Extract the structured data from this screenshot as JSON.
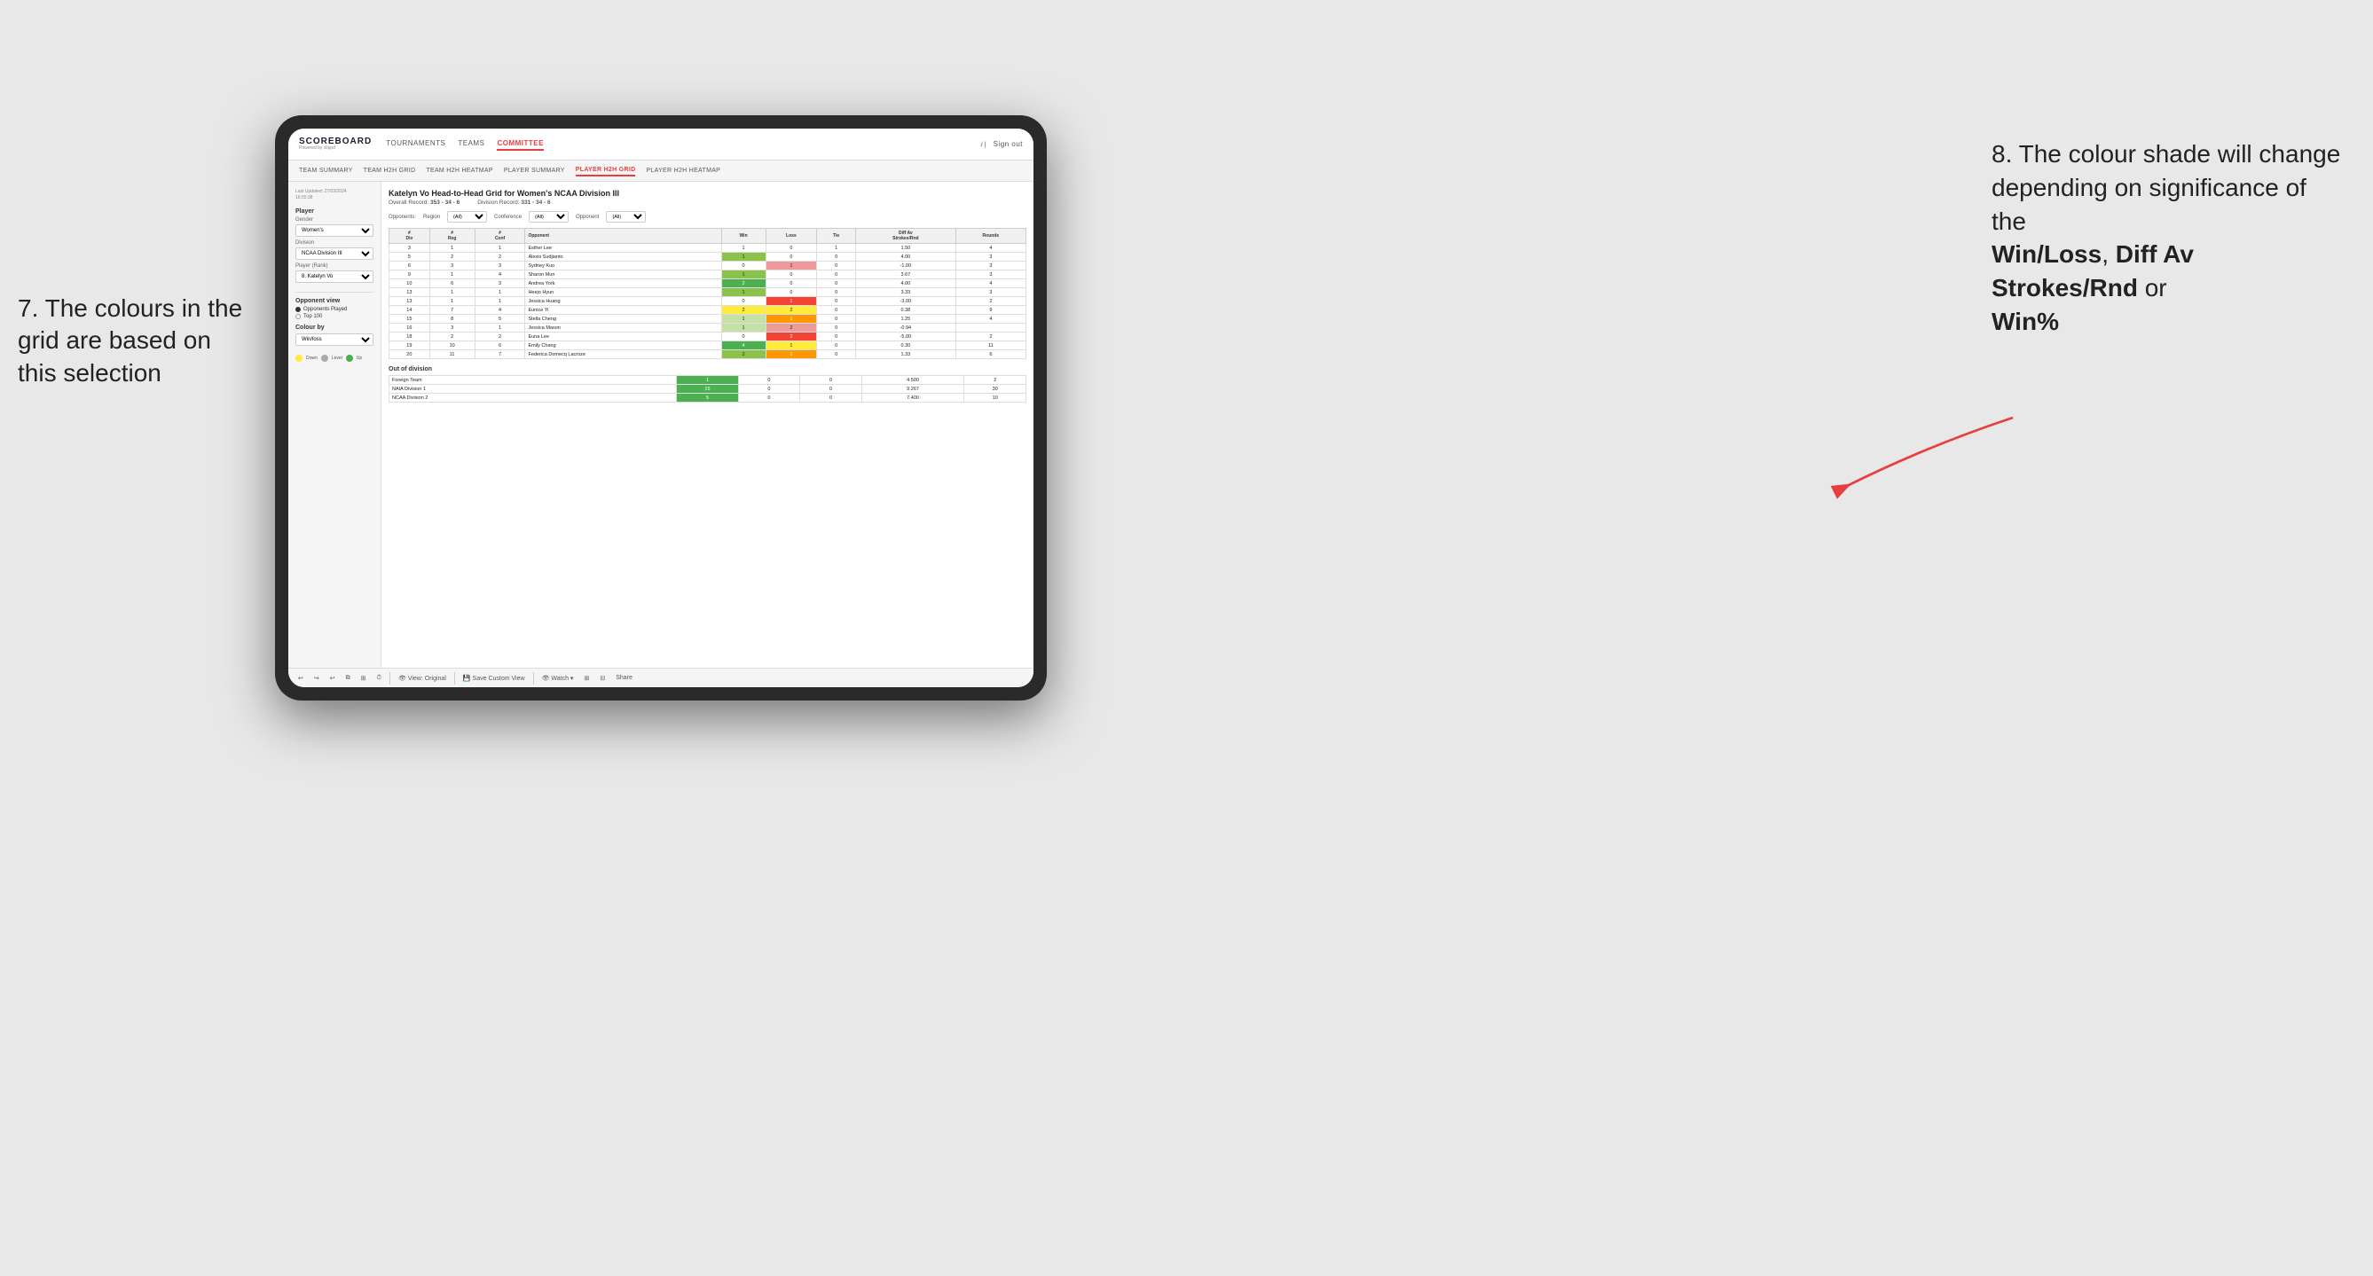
{
  "annotations": {
    "left_title": "7. The colours in the grid are based on this selection",
    "right_title": "8. The colour shade will change depending on significance of the",
    "right_bold1": "Win/Loss",
    "right_bold2": "Diff Av Strokes/Rnd",
    "right_bold3": "Win%",
    "right_connector": "or"
  },
  "nav": {
    "logo": "SCOREBOARD",
    "logo_sub": "Powered by clippd",
    "items": [
      "TOURNAMENTS",
      "TEAMS",
      "COMMITTEE"
    ],
    "right": [
      "Sign out"
    ]
  },
  "subnav": {
    "items": [
      "TEAM SUMMARY",
      "TEAM H2H GRID",
      "TEAM H2H HEATMAP",
      "PLAYER SUMMARY",
      "PLAYER H2H GRID",
      "PLAYER H2H HEATMAP"
    ]
  },
  "left_panel": {
    "last_updated_label": "Last Updated: 27/03/2024",
    "last_updated_time": "16:55:38",
    "player_label": "Player",
    "gender_label": "Gender",
    "gender_value": "Women's",
    "division_label": "Division",
    "division_value": "NCAA Division III",
    "player_rank_label": "Player (Rank)",
    "player_rank_value": "8. Katelyn Vo",
    "opponent_view_label": "Opponent view",
    "radio1": "Opponents Played",
    "radio2": "Top 100",
    "colour_by_label": "Colour by",
    "colour_by_value": "Win/loss",
    "legend_down": "Down",
    "legend_level": "Level",
    "legend_up": "Up"
  },
  "main": {
    "title": "Katelyn Vo Head-to-Head Grid for Women's NCAA Division III",
    "overall_record_label": "Overall Record:",
    "overall_record": "353 - 34 - 6",
    "division_record_label": "Division Record:",
    "division_record": "331 - 34 - 6",
    "opponents_label": "Opponents:",
    "region_label": "Region",
    "conference_label": "Conference",
    "opponent_label": "Opponent",
    "filter_all": "(All)",
    "col_headers": [
      "#\nDiv",
      "#\nReg",
      "#\nConf",
      "Opponent",
      "Win",
      "Loss",
      "Tie",
      "Diff Av\nStrokes/Rnd",
      "Rounds"
    ],
    "rows": [
      {
        "div": "3",
        "reg": "1",
        "conf": "1",
        "opponent": "Esther Lee",
        "win": "1",
        "loss": "0",
        "tie": "1",
        "diff": "1.50",
        "rounds": "4",
        "win_color": "white",
        "loss_color": "white"
      },
      {
        "div": "5",
        "reg": "2",
        "conf": "2",
        "opponent": "Alexis Sudjianto",
        "win": "1",
        "loss": "0",
        "tie": "0",
        "diff": "4.00",
        "rounds": "3",
        "win_color": "green_med",
        "loss_color": "white"
      },
      {
        "div": "6",
        "reg": "3",
        "conf": "3",
        "opponent": "Sydney Kuo",
        "win": "0",
        "loss": "1",
        "tie": "0",
        "diff": "-1.00",
        "rounds": "3",
        "win_color": "white",
        "loss_color": "red_light"
      },
      {
        "div": "9",
        "reg": "1",
        "conf": "4",
        "opponent": "Sharon Mun",
        "win": "1",
        "loss": "0",
        "tie": "0",
        "diff": "3.67",
        "rounds": "3",
        "win_color": "green_med",
        "loss_color": "white"
      },
      {
        "div": "10",
        "reg": "6",
        "conf": "3",
        "opponent": "Andrea York",
        "win": "2",
        "loss": "0",
        "tie": "0",
        "diff": "4.00",
        "rounds": "4",
        "win_color": "green_dark",
        "loss_color": "white"
      },
      {
        "div": "13",
        "reg": "1",
        "conf": "1",
        "opponent": "Heejo Hyun",
        "win": "1",
        "loss": "0",
        "tie": "0",
        "diff": "3.33",
        "rounds": "3",
        "win_color": "green_med",
        "loss_color": "white"
      },
      {
        "div": "13",
        "reg": "1",
        "conf": "1",
        "opponent": "Jessica Huang",
        "win": "0",
        "loss": "1",
        "tie": "0",
        "diff": "-3.00",
        "rounds": "2",
        "win_color": "white",
        "loss_color": "red_dark"
      },
      {
        "div": "14",
        "reg": "7",
        "conf": "4",
        "opponent": "Eunice Yi",
        "win": "2",
        "loss": "2",
        "tie": "0",
        "diff": "0.38",
        "rounds": "9",
        "win_color": "yellow",
        "loss_color": "yellow"
      },
      {
        "div": "15",
        "reg": "8",
        "conf": "5",
        "opponent": "Stella Cheng",
        "win": "1",
        "loss": "1",
        "tie": "0",
        "diff": "1.25",
        "rounds": "4",
        "win_color": "green_light",
        "loss_color": "orange"
      },
      {
        "div": "16",
        "reg": "3",
        "conf": "1",
        "opponent": "Jessica Mason",
        "win": "1",
        "loss": "2",
        "tie": "0",
        "diff": "-0.94",
        "rounds": "",
        "win_color": "green_light",
        "loss_color": "red_med"
      },
      {
        "div": "18",
        "reg": "2",
        "conf": "2",
        "opponent": "Euna Lee",
        "win": "0",
        "loss": "2",
        "tie": "0",
        "diff": "-5.00",
        "rounds": "2",
        "win_color": "white",
        "loss_color": "red_dark"
      },
      {
        "div": "19",
        "reg": "10",
        "conf": "6",
        "opponent": "Emily Chang",
        "win": "4",
        "loss": "1",
        "tie": "0",
        "diff": "0.30",
        "rounds": "11",
        "win_color": "green_dark",
        "loss_color": "yellow"
      },
      {
        "div": "20",
        "reg": "11",
        "conf": "7",
        "opponent": "Federica Domecq Lacroze",
        "win": "2",
        "loss": "1",
        "tie": "0",
        "diff": "1.33",
        "rounds": "6",
        "win_color": "green_med",
        "loss_color": "orange"
      }
    ],
    "out_of_division_label": "Out of division",
    "out_of_division_rows": [
      {
        "name": "Foreign Team",
        "win": "1",
        "loss": "0",
        "tie": "0",
        "diff": "4.500",
        "rounds": "2",
        "win_color": "green_dark"
      },
      {
        "name": "NAIA Division 1",
        "win": "15",
        "loss": "0",
        "tie": "0",
        "diff": "9.267",
        "rounds": "30",
        "win_color": "green_dark"
      },
      {
        "name": "NCAA Division 2",
        "win": "5",
        "loss": "0",
        "tie": "0",
        "diff": "7.400",
        "rounds": "10",
        "win_color": "green_dark"
      }
    ]
  },
  "toolbar": {
    "view_original": "View: Original",
    "save_custom": "Save Custom View",
    "watch": "Watch",
    "share": "Share"
  }
}
